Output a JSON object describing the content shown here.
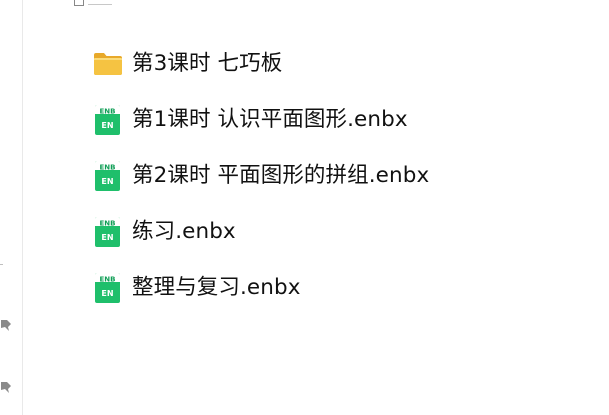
{
  "files": [
    {
      "name": "第3课时 七巧板",
      "type": "folder",
      "icon": "folder-icon"
    },
    {
      "name": "第1课时 认识平面图形.enbx",
      "type": "enbx",
      "icon": "enbx-file-icon",
      "badge_top": "ENB",
      "badge_bottom": "EN"
    },
    {
      "name": "第2课时 平面图形的拼组.enbx",
      "type": "enbx",
      "icon": "enbx-file-icon",
      "badge_top": "ENB",
      "badge_bottom": "EN"
    },
    {
      "name": "练习.enbx",
      "type": "enbx",
      "icon": "enbx-file-icon",
      "badge_top": "ENB",
      "badge_bottom": "EN"
    },
    {
      "name": "整理与复习.enbx",
      "type": "enbx",
      "icon": "enbx-file-icon",
      "badge_top": "ENB",
      "badge_bottom": "EN"
    }
  ],
  "colors": {
    "folder": "#f5c342",
    "folder_dark": "#e8a92a",
    "enbx_green": "#1fbf6b",
    "enbx_dark": "#0e9e55",
    "text": "#111111"
  },
  "left_rail": {
    "pin_icons": [
      "pin-icon",
      "pin-icon"
    ]
  }
}
